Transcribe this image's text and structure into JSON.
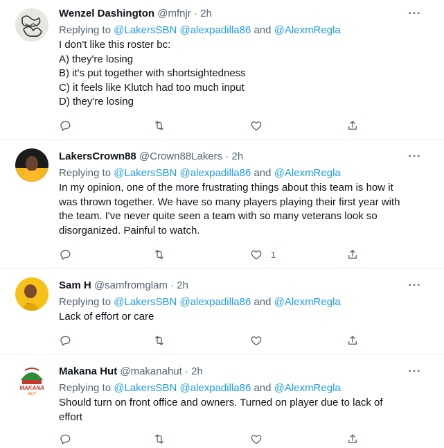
{
  "tweets": [
    {
      "name": "Wenzel Dashington",
      "handle": "@mfnjr",
      "time": "2h",
      "replying_prefix": "Replying to ",
      "mention1": "@LakersSBN",
      "mention2": "@alexpadilla86",
      "and": " and ",
      "mention3": "@AlexmRegla",
      "lines": [
        "I don't like this roster bc:",
        "A) they're losing",
        "B) it's put together with shortsightedness",
        "C) it feels like Klutch had too much input",
        "D) they're losing"
      ],
      "like_count": ""
    },
    {
      "name": "LakersCrown88",
      "handle": "@Crown88Lakers",
      "time": "2h",
      "replying_prefix": "Replying to ",
      "mention1": "@LakersSBN",
      "mention2": "@alexpadilla86",
      "and": " and ",
      "mention3": "@AlexmRegla",
      "lines": [
        "In my opinion, one of the more frustrating things about this team is how it",
        "was thrown together. We have so many players playing their first year with",
        "the team. I've never quite seen a team with so many veterans look so",
        "disorganized. Painful to watch."
      ],
      "like_count": "1"
    },
    {
      "name": "Sam H",
      "handle": "@samfromglam",
      "time": "2h",
      "replying_prefix": "Replying to ",
      "mention1": "@LakersSBN",
      "mention2": "@alexpadilla86",
      "and": " and ",
      "mention3": "@AlexmRegla",
      "lines": [
        "Lack of effort or care"
      ],
      "like_count": ""
    },
    {
      "name": "Makana Hut",
      "handle": "@makanahut",
      "time": "2h",
      "replying_prefix": "Replying to ",
      "mention1": "@LakersSBN",
      "mention2": "@alexpadilla86",
      "and": " and ",
      "mention3": "@AlexmRegla",
      "lines": [
        "Should turn on front office and owners. Turned on player due to lack of",
        "effort"
      ],
      "like_count": "",
      "avatar_text_top": "MAKANA",
      "avatar_text_bottom": "HUT"
    }
  ],
  "colors": {
    "link": "#1d9bf0",
    "muted": "#536471",
    "text": "#0f1419",
    "divider": "#eff3f4"
  },
  "icons": [
    "reply-icon",
    "retweet-icon",
    "like-icon",
    "share-icon",
    "more-icon"
  ],
  "separator": " · ",
  "more_glyph": "···"
}
